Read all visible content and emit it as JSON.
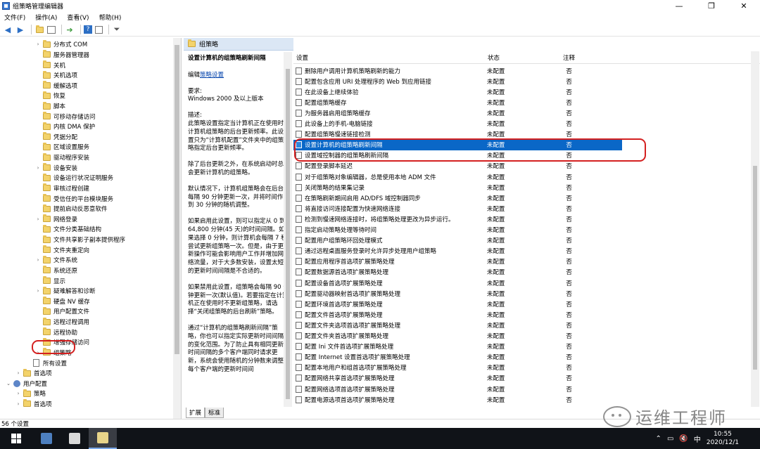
{
  "window": {
    "title": "组策略管理编辑器",
    "minimize": "—",
    "restore": "❐",
    "close": "✕"
  },
  "menu": [
    "文件(F)",
    "操作(A)",
    "查看(V)",
    "帮助(H)"
  ],
  "tree": {
    "items": [
      {
        "label": "分布式 COM",
        "indent": 3,
        "expander": "›"
      },
      {
        "label": "服务器管理器",
        "indent": 3,
        "expander": ""
      },
      {
        "label": "关机",
        "indent": 3,
        "expander": ""
      },
      {
        "label": "关机选项",
        "indent": 3,
        "expander": ""
      },
      {
        "label": "缓解选项",
        "indent": 3,
        "expander": ""
      },
      {
        "label": "恢复",
        "indent": 3,
        "expander": ""
      },
      {
        "label": "脚本",
        "indent": 3,
        "expander": ""
      },
      {
        "label": "可移动存储访问",
        "indent": 3,
        "expander": ""
      },
      {
        "label": "内核 DMA 保护",
        "indent": 3,
        "expander": ""
      },
      {
        "label": "凭据分配",
        "indent": 3,
        "expander": ""
      },
      {
        "label": "区域设置服务",
        "indent": 3,
        "expander": ""
      },
      {
        "label": "驱动程序安装",
        "indent": 3,
        "expander": ""
      },
      {
        "label": "设备安装",
        "indent": 3,
        "expander": "›"
      },
      {
        "label": "设备运行状况证明服务",
        "indent": 3,
        "expander": ""
      },
      {
        "label": "审核过程创建",
        "indent": 3,
        "expander": ""
      },
      {
        "label": "受信任的平台模块服务",
        "indent": 3,
        "expander": ""
      },
      {
        "label": "提前启动反恶意软件",
        "indent": 3,
        "expander": ""
      },
      {
        "label": "网络登录",
        "indent": 3,
        "expander": "›"
      },
      {
        "label": "文件分类基础结构",
        "indent": 3,
        "expander": ""
      },
      {
        "label": "文件共享影子副本提供程序",
        "indent": 3,
        "expander": ""
      },
      {
        "label": "文件夹重定向",
        "indent": 3,
        "expander": ""
      },
      {
        "label": "文件系统",
        "indent": 3,
        "expander": "›"
      },
      {
        "label": "系统还原",
        "indent": 3,
        "expander": ""
      },
      {
        "label": "显示",
        "indent": 3,
        "expander": ""
      },
      {
        "label": "疑难解答和诊断",
        "indent": 3,
        "expander": "›"
      },
      {
        "label": "硬盘 NV 缓存",
        "indent": 3,
        "expander": ""
      },
      {
        "label": "用户配置文件",
        "indent": 3,
        "expander": ""
      },
      {
        "label": "远程过程调用",
        "indent": 3,
        "expander": ""
      },
      {
        "label": "远程协助",
        "indent": 3,
        "expander": ""
      },
      {
        "label": "增强存储访问",
        "indent": 3,
        "expander": ""
      },
      {
        "label": "组策略",
        "indent": 3,
        "expander": "›"
      },
      {
        "label": "所有设置",
        "indent": 2,
        "expander": "",
        "icon": "doc"
      },
      {
        "label": "首选项",
        "indent": 1,
        "expander": "›"
      },
      {
        "label": "用户配置",
        "indent": 0,
        "expander": "⌄",
        "icon": "user"
      },
      {
        "label": "策略",
        "indent": 1,
        "expander": "›"
      },
      {
        "label": "首选项",
        "indent": 1,
        "expander": "›"
      }
    ]
  },
  "desc": {
    "header": "组策略",
    "heading": "设置计算机的组策略刷新间隔",
    "edit_prefix": "编辑",
    "edit_link": "策略设置",
    "req_label": "要求:",
    "req_value": "Windows 2000 及以上版本",
    "desc_label": "描述:",
    "p1": "此策略设置指定当计算机正在使用时计算机组策略的后台更新频率。此设置只为“计算机配置”文件夹中的组策略指定后台更新频率。",
    "p2": "除了后台更新之外，在系统启动时总会更新计算机的组策略。",
    "p3": "默认情况下，计算机组策略会在后台每隔 90 分钟更新一次，并将时间作 0 到 30 分钟的随机调整。",
    "p4": "如果启用此设置，则可以指定从 0 到 64,800 分钟(45 天)的时间间隔。如果选择 0 分钟，则计算机会每隔 7 秒尝试更新组策略一次。但是，由于更新操作可能会影响用户工作并增加网络流量，对于大多数安装，设置太短的更新时间间隔是不合适的。",
    "p5": "如果禁用此设置，组策略会每隔 90 分钟更新一次(默认值)。若要指定在计算机正在使用时不更新组策略，请选择“关闭组策略的后台刷新”策略。",
    "p6": "通过“计算机的组策略刷新间隔”策略，你也可以指定实际更新时间间隔的变化范围。为了防止具有相同更新时间间隔的多个客户端同时请求更新，系统会使用随机的分钟数来调整每个客户端的更新时间间"
  },
  "tabs": [
    "扩展",
    "标准"
  ],
  "list": {
    "headers": {
      "setting": "设置",
      "state": "状态",
      "note": "注释"
    },
    "rows": [
      {
        "name": "删除用户调用计算机策略刷新的能力",
        "state": "未配置",
        "note": "否"
      },
      {
        "name": "配置包含应用 URI 处理程序的 Web 到应用链接",
        "state": "未配置",
        "note": "否"
      },
      {
        "name": "在此设备上继续体验",
        "state": "未配置",
        "note": "否"
      },
      {
        "name": "配置组策略缓存",
        "state": "未配置",
        "note": "否"
      },
      {
        "name": "为服务器启用组策略缓存",
        "state": "未配置",
        "note": "否"
      },
      {
        "name": "此设备上的手机-电脑链接",
        "state": "未配置",
        "note": "否"
      },
      {
        "name": "配置组策略慢速链接检测",
        "state": "未配置",
        "note": "否"
      },
      {
        "name": "设置计算机的组策略刷新间隔",
        "state": "未配置",
        "note": "否",
        "selected": true
      },
      {
        "name": "设置域控制器的组策略刷新间隔",
        "state": "未配置",
        "note": "否"
      },
      {
        "name": "配置登录脚本延迟",
        "state": "未配置",
        "note": "否"
      },
      {
        "name": "对于组策略对象编辑器，总是使用本地 ADM 文件",
        "state": "未配置",
        "note": "否"
      },
      {
        "name": "关闭策略的结果集记录",
        "state": "未配置",
        "note": "否"
      },
      {
        "name": "在策略刷新期间启用 AD/DFS 域控制器同步",
        "state": "未配置",
        "note": "否"
      },
      {
        "name": "将直接访问连接配置为快速网络连接",
        "state": "未配置",
        "note": "否"
      },
      {
        "name": "检测到慢速网络连接时，将组策略处理更改为异步运行。",
        "state": "未配置",
        "note": "否"
      },
      {
        "name": "指定启动策略处理等待时间",
        "state": "未配置",
        "note": "否"
      },
      {
        "name": "配置用户组策略环回处理模式",
        "state": "未配置",
        "note": "否"
      },
      {
        "name": "通过远程桌面服务登录时允许异步处理用户组策略",
        "state": "未配置",
        "note": "否"
      },
      {
        "name": "配置应用程序首选项扩展策略处理",
        "state": "未配置",
        "note": "否"
      },
      {
        "name": "配置数据源首选项扩展策略处理",
        "state": "未配置",
        "note": "否"
      },
      {
        "name": "配置设备首选项扩展策略处理",
        "state": "未配置",
        "note": "否"
      },
      {
        "name": "配置驱动器映射首选项扩展策略处理",
        "state": "未配置",
        "note": "否"
      },
      {
        "name": "配置环境首选项扩展策略处理",
        "state": "未配置",
        "note": "否"
      },
      {
        "name": "配置文件首选项扩展策略处理",
        "state": "未配置",
        "note": "否"
      },
      {
        "name": "配置文件夹选项首选项扩展策略处理",
        "state": "未配置",
        "note": "否"
      },
      {
        "name": "配置文件夹首选项扩展策略处理",
        "state": "未配置",
        "note": "否"
      },
      {
        "name": "配置 Ini 文件首选项扩展策略处理",
        "state": "未配置",
        "note": "否"
      },
      {
        "name": "配置 Internet 设置首选项扩展策略处理",
        "state": "未配置",
        "note": "否"
      },
      {
        "name": "配置本地用户和组首选项扩展策略处理",
        "state": "未配置",
        "note": "否"
      },
      {
        "name": "配置网络共享首选项扩展策略处理",
        "state": "未配置",
        "note": "否"
      },
      {
        "name": "配置网络选项首选项扩展策略处理",
        "state": "未配置",
        "note": "否"
      },
      {
        "name": "配置电源选项首选项扩展策略处理",
        "state": "未配置",
        "note": "否"
      }
    ]
  },
  "status": "56 个设置",
  "watermark": "运维工程师",
  "taskbar": {
    "time": "10:55",
    "date": "2020/12/1",
    "ime": "中"
  }
}
